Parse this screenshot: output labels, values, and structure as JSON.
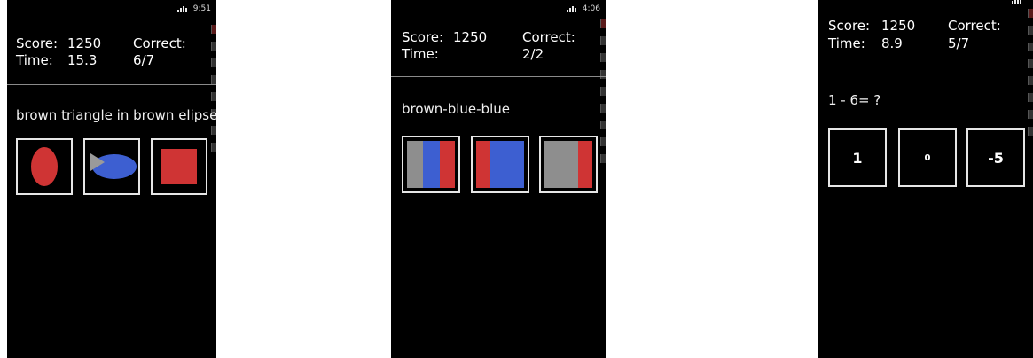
{
  "screens": [
    {
      "status_time": "9:51",
      "score_label": "Score:",
      "score_value": "1250",
      "time_label": "Time:",
      "time_value": "15.3",
      "correct_label": "Correct:",
      "correct_value": "6/7",
      "prompt": "brown triangle in brown elipse",
      "choices": [
        "red-ellipse",
        "blue-ellipse-with-gray-triangle",
        "red-square"
      ]
    },
    {
      "status_time": "4:06",
      "score_label": "Score:",
      "score_value": "1250",
      "time_label": "Time:",
      "time_value": "",
      "correct_label": "Correct:",
      "correct_value": "2/2",
      "prompt": "brown-blue-blue",
      "choices": [
        "gray-blue-red stripes",
        "red-blue stripes",
        "gray-red stripes"
      ]
    },
    {
      "status_time": "",
      "score_label": "Score:",
      "score_value": "1250",
      "time_label": "Time:",
      "time_value": "8.9",
      "correct_label": "Correct:",
      "correct_value": "5/7",
      "prompt": "1 - 6= ?",
      "answers": [
        "1",
        "0",
        "-5"
      ]
    }
  ],
  "colors": {
    "red": "#cf3434",
    "blue": "#3d5fd1",
    "gray": "#8e8e8e",
    "background": "#000000"
  }
}
